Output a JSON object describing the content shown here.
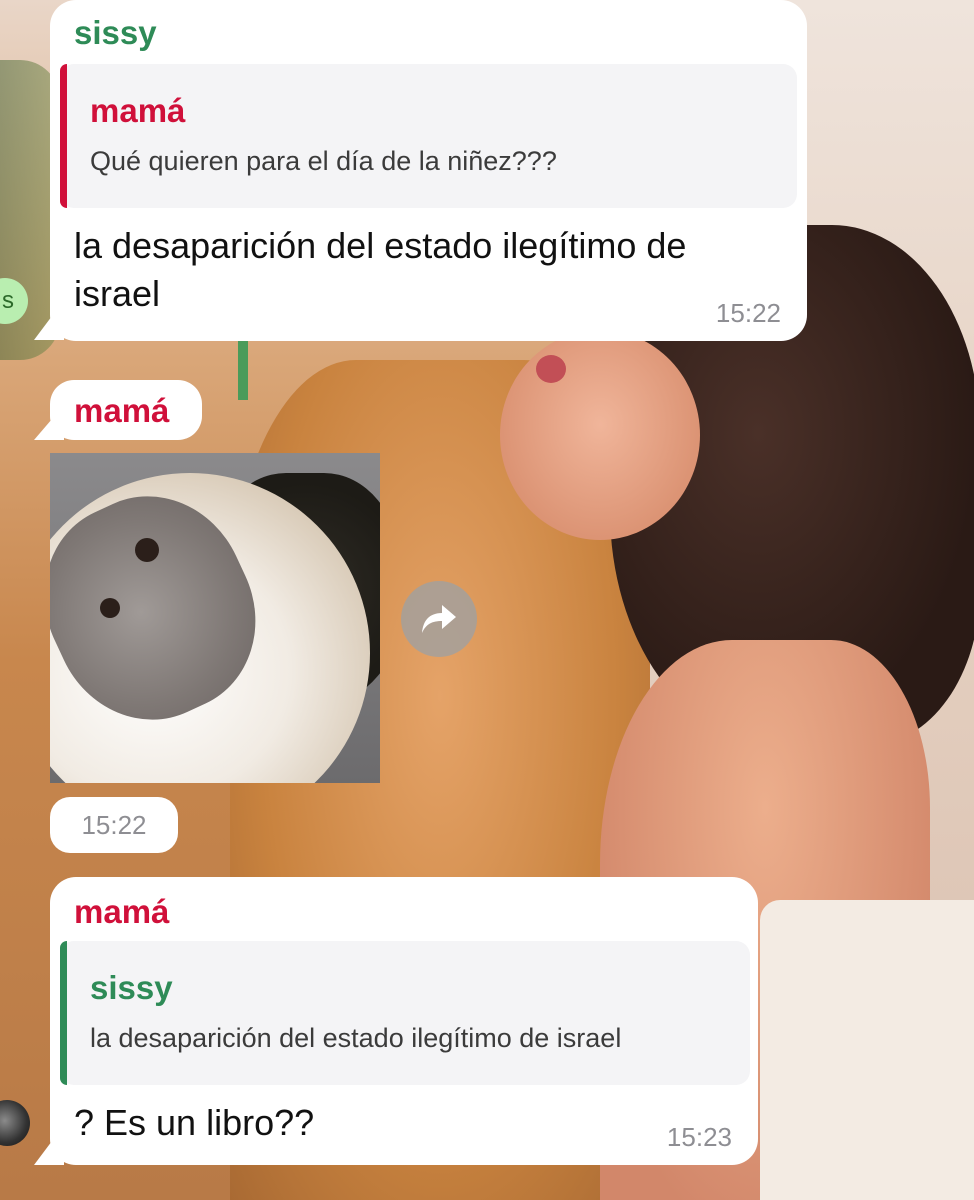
{
  "messages": [
    {
      "sender": "sissy",
      "reply_to": {
        "sender": "mamá",
        "text": "Qué quieren para el día de la niñez???"
      },
      "text_lines": [
        "la desaparición del estado ilegítimo de",
        "israel"
      ],
      "time": "15:22"
    },
    {
      "sender": "mamá",
      "media": "monkey-gif",
      "time": "15:22"
    },
    {
      "sender": "mamá",
      "reply_to": {
        "sender": "sissy",
        "text": "la desaparición del estado ilegítimo de israel"
      },
      "text": "? Es un libro??",
      "time": "15:23"
    }
  ],
  "avatars": {
    "sissy_initial": "s"
  },
  "icons": {
    "share": "share-arrow-icon"
  },
  "colors": {
    "sissy_name": "#2e8b57",
    "mama_name": "#d0103a",
    "time": "#8e8e93"
  }
}
